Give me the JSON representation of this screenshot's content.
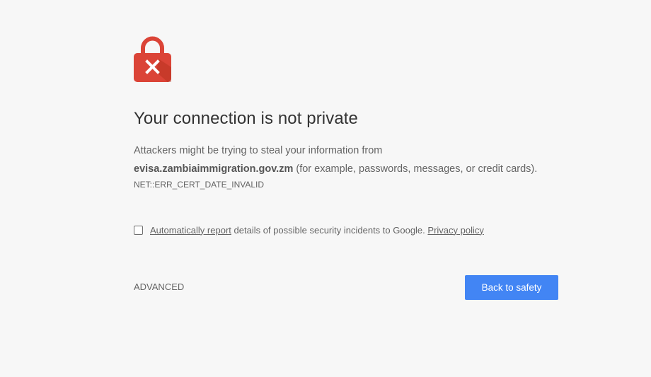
{
  "interstitial": {
    "icon": "lock-error-icon",
    "colors": {
      "icon_red": "#db4437",
      "button_blue": "#4285f4",
      "background": "#f7f7f7"
    },
    "title": "Your connection is not private",
    "message_prefix": "Attackers might be trying to steal your information from",
    "domain": "evisa.zambiaimmigration.gov.zm",
    "message_suffix": "(for example, passwords, messages, or credit cards).",
    "error_code": "NET::ERR_CERT_DATE_INVALID",
    "report": {
      "checked": false,
      "link_label": "Automatically report",
      "text": "details of possible security incidents to Google.",
      "privacy_label": "Privacy policy"
    },
    "advanced_label": "ADVANCED",
    "back_label": "Back to safety"
  }
}
